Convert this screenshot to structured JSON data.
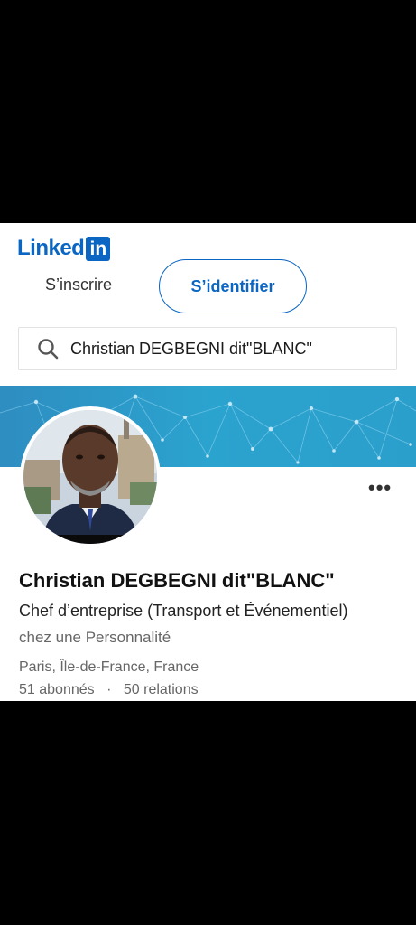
{
  "header": {
    "logo_text": "Linked",
    "logo_box": "in",
    "signup_label": "S’inscrire",
    "signin_label": "S’identifier"
  },
  "search": {
    "value": "Christian DEGBEGNI dit\"BLANC\"",
    "icon": "search-icon"
  },
  "profile": {
    "name": "Christian DEGBEGNI dit\"BLANC\"",
    "headline": "Chef d’entreprise (Transport et Événementiel)",
    "company": "chez une Personnalité",
    "location": "Paris, Île-de-France, France",
    "followers": "51 abonnés",
    "separator": "·",
    "connections": "50 relations",
    "more_icon": "more-options-icon"
  },
  "colors": {
    "brand": "#0a66c2",
    "banner": "#2ba3cf"
  }
}
